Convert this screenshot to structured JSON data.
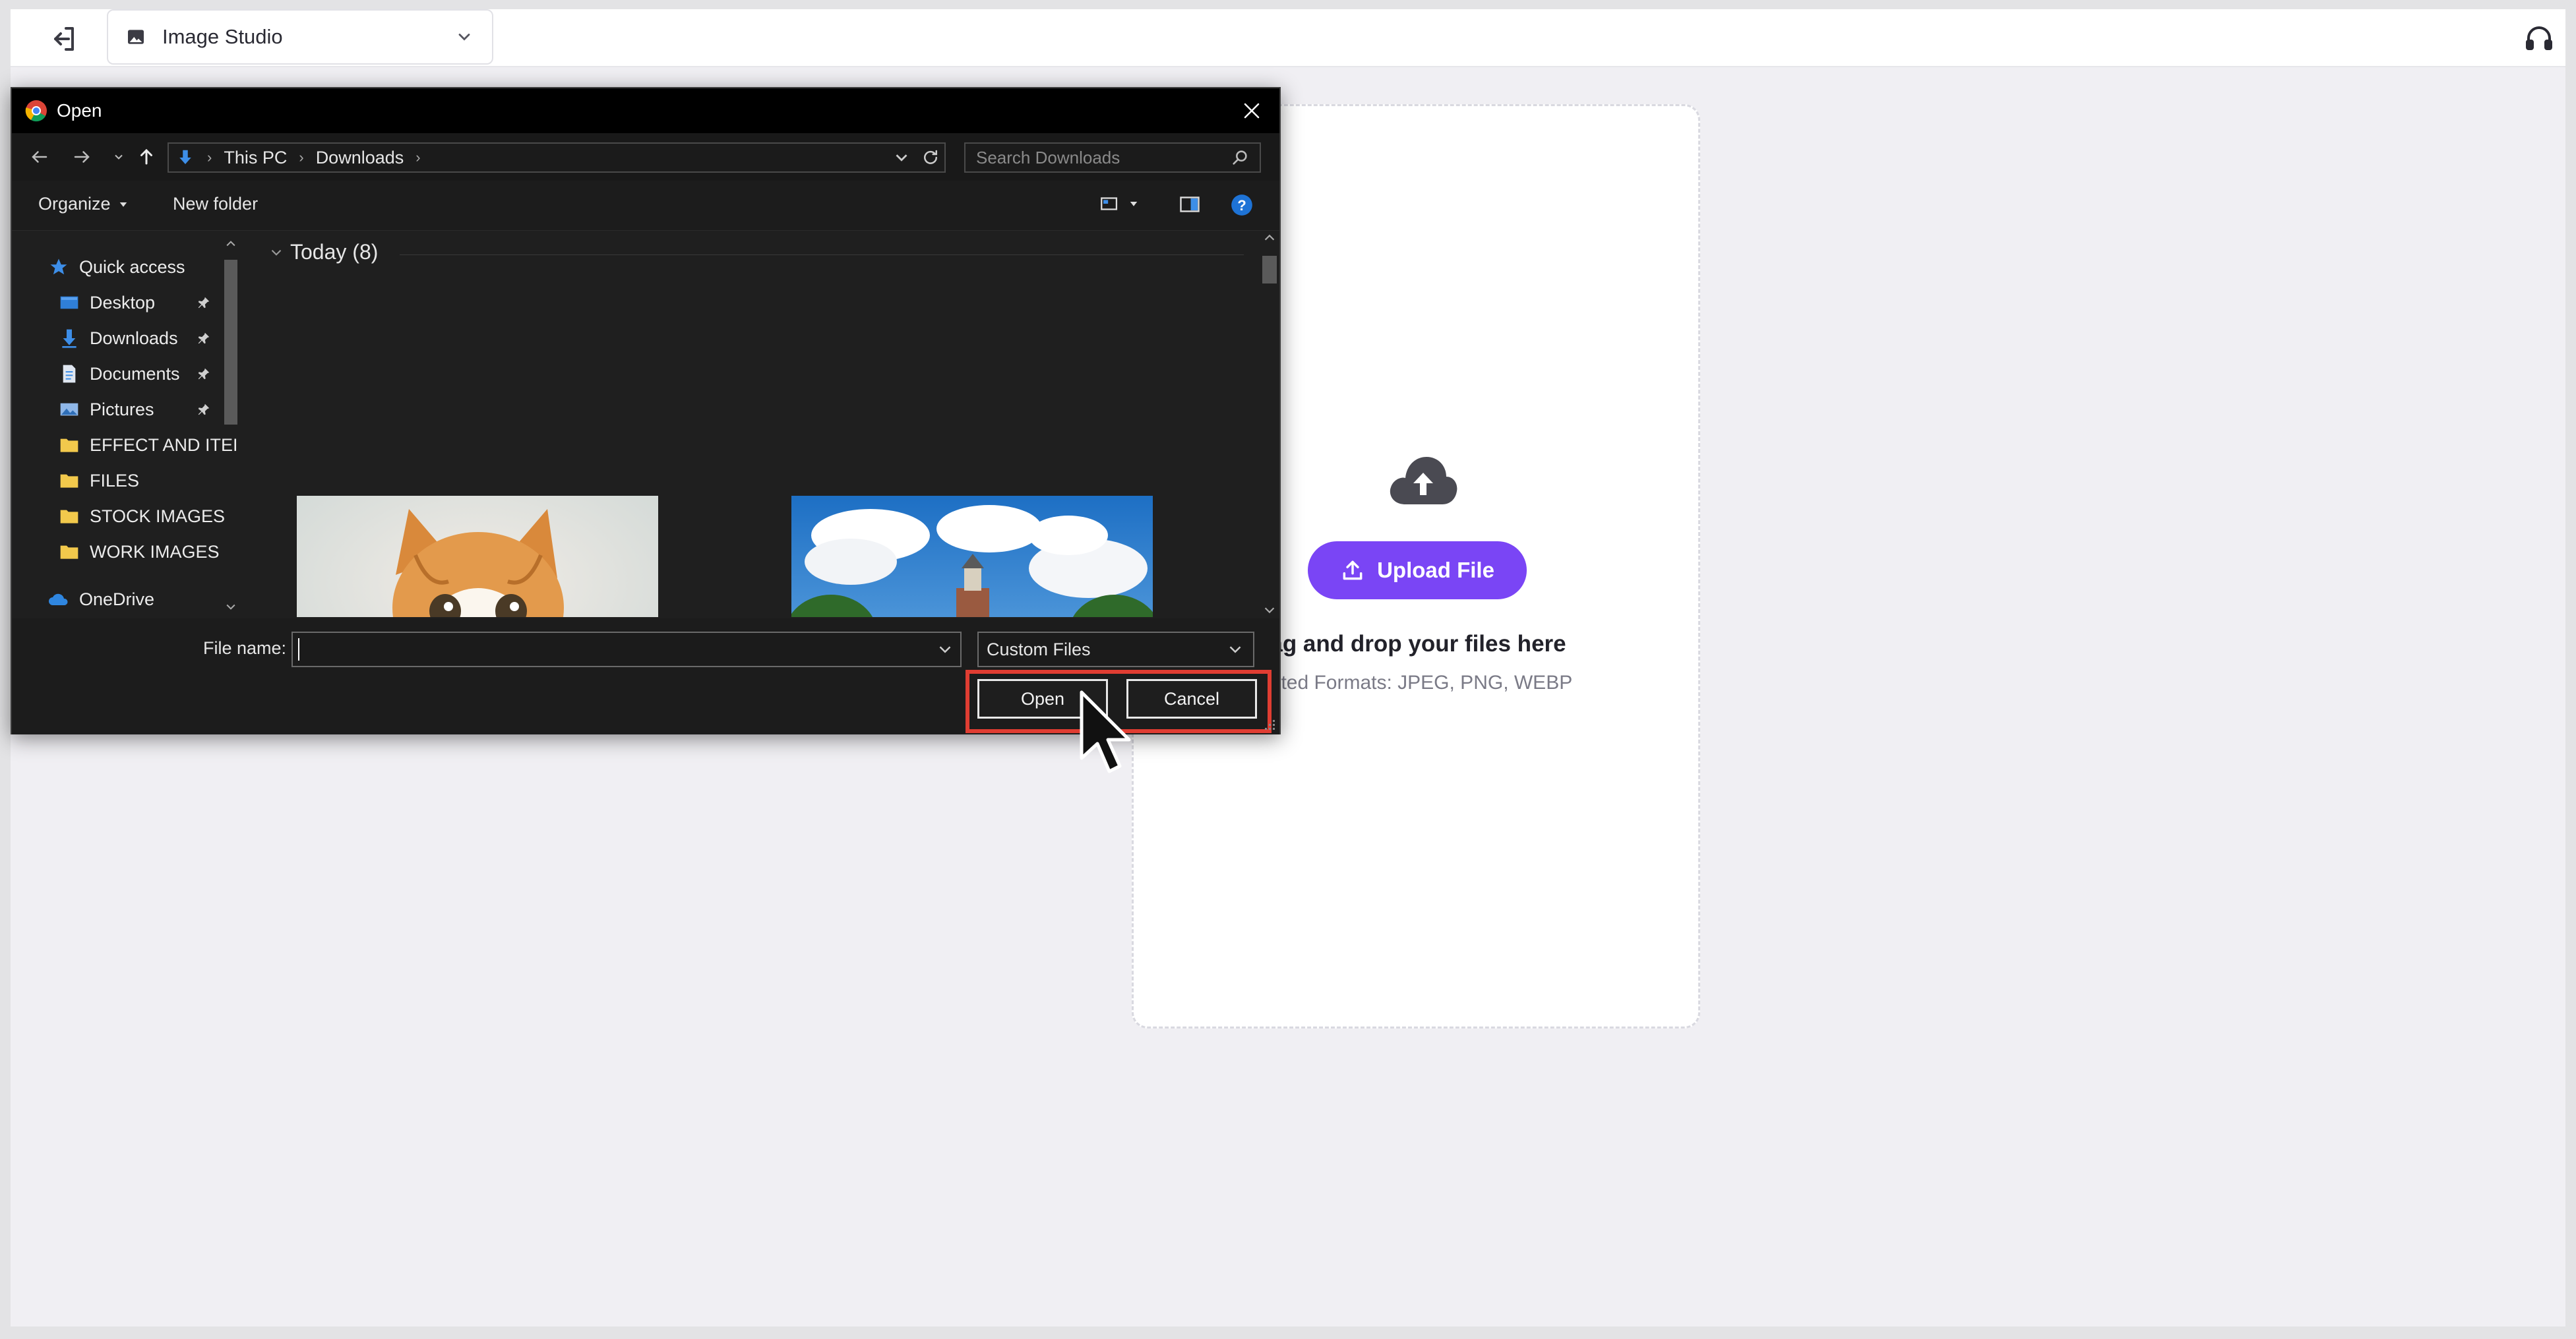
{
  "app": {
    "studio_label": "Image Studio",
    "accent_color": "#7a45f5"
  },
  "icons": {
    "exit": "logout-icon",
    "studio": "image-icon",
    "chevron": "chevron-down-icon",
    "support": "headset-icon",
    "upload_cloud": "cloud-upload-icon",
    "upload_button": "upload-icon"
  },
  "upload_panel": {
    "button_label": "Upload File",
    "drop_title": "ag and drop your files here",
    "supported_formats": "orted Formats: JPEG, PNG, WEBP"
  },
  "dialog": {
    "title": "Open",
    "breadcrumb": [
      "This PC",
      "Downloads"
    ],
    "search_placeholder": "Search Downloads",
    "toolbar": {
      "organize": "Organize",
      "new_folder": "New folder"
    },
    "nav": {
      "quick_access": "Quick access",
      "items": [
        {
          "label": "Desktop",
          "pinned": true
        },
        {
          "label": "Downloads",
          "pinned": true
        },
        {
          "label": "Documents",
          "pinned": true
        },
        {
          "label": "Pictures",
          "pinned": true
        },
        {
          "label": "EFFECT AND ITEI",
          "pinned": false
        },
        {
          "label": "FILES",
          "pinned": false
        },
        {
          "label": "STOCK IMAGES",
          "pinned": false
        },
        {
          "label": "WORK IMAGES",
          "pinned": false
        }
      ],
      "onedrive": "OneDrive"
    },
    "content": {
      "group_label": "Today (8)",
      "thumbnails": [
        "kitten photo",
        "school building photo"
      ]
    },
    "footer": {
      "file_name_label": "File name:",
      "file_name_value": "",
      "filter_value": "Custom Files",
      "open_label": "Open",
      "cancel_label": "Cancel"
    },
    "highlight_color": "#e03d32"
  }
}
